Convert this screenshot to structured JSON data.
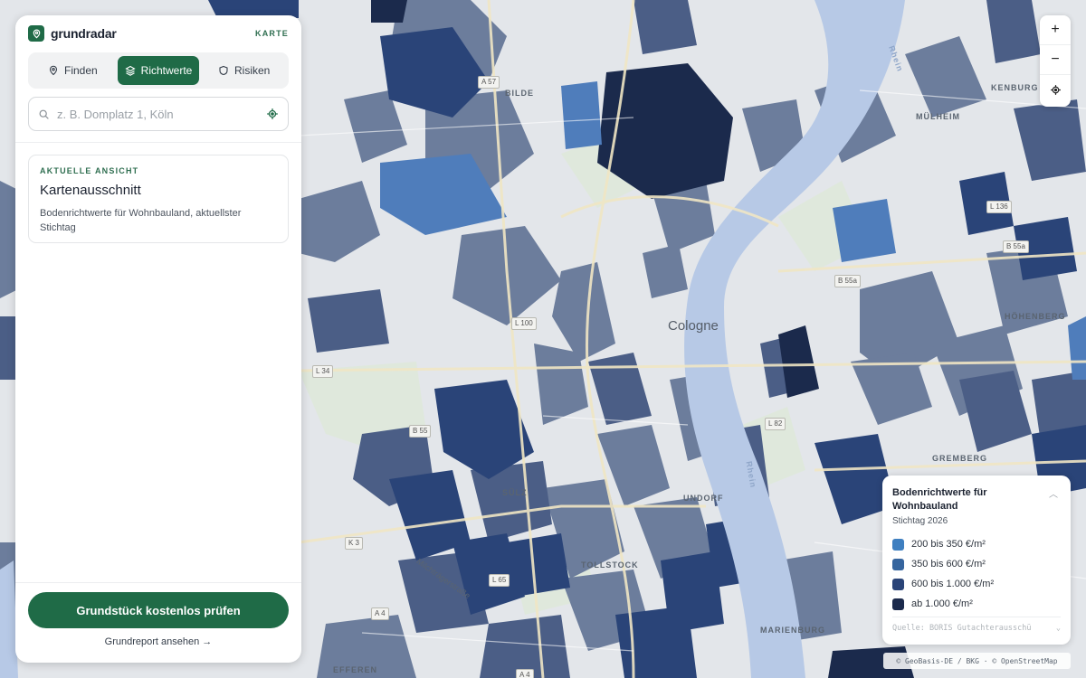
{
  "app": {
    "brand": "grundradar",
    "mode_label": "KARTE"
  },
  "tabs": [
    {
      "label": "Finden",
      "icon": "map-pin-icon",
      "active": false
    },
    {
      "label": "Richtwerte",
      "icon": "layers-icon",
      "active": true
    },
    {
      "label": "Risiken",
      "icon": "shield-icon",
      "active": false
    }
  ],
  "search": {
    "value": "",
    "placeholder": "z. B. Domplatz 1, Köln"
  },
  "card": {
    "eyebrow": "AKTUELLE ANSICHT",
    "title": "Kartenausschnitt",
    "description": "Bodenrichtwerte für Wohnbauland, aktuellster Stichtag"
  },
  "cta": {
    "label": "Grundstück kostenlos prüfen",
    "secondary": "Grundreport ansehen →"
  },
  "map_controls": {
    "zoom_in": "+",
    "zoom_out": "−"
  },
  "map": {
    "city": "Cologne",
    "labels": [
      "BILDE",
      "SÜLZ",
      "TOLLSTOCK",
      "UNDORF",
      "GREMBERG",
      "MÜLHEIM",
      "KENBURG",
      "HÖHENBERG",
      "MARIENBURG",
      "EFFEREN",
      "Rhein",
      "Rhein",
      "Milchträgerstraße"
    ],
    "roads": [
      "A 57",
      "L 100",
      "L 34",
      "B 55a",
      "B 55a",
      "L 82",
      "K 3",
      "A 4",
      "B 55",
      "A 4",
      "L 65",
      "L 136"
    ]
  },
  "legend": {
    "title": "Bodenrichtwerte für Wohnbauland",
    "subtitle": "Stichtag 2026",
    "items": [
      {
        "label": "200 bis 350 €/m²",
        "color": "#3f7fc0"
      },
      {
        "label": "350 bis 600 €/m²",
        "color": "#36659e"
      },
      {
        "label": "600 bis 1.000 €/m²",
        "color": "#2a4478"
      },
      {
        "label": "ab 1.000 €/m²",
        "color": "#1b2a4c"
      }
    ],
    "source": "Quelle: BORIS Gutachterausschü",
    "attribution": "© GeoBasis-DE / BKG · © OpenStreetMap"
  },
  "colors": {
    "accent": "#1f6b47",
    "river": "#b7c9e6",
    "tier_low": "#6c7d9c",
    "tier_mid": "#4b5e86"
  }
}
